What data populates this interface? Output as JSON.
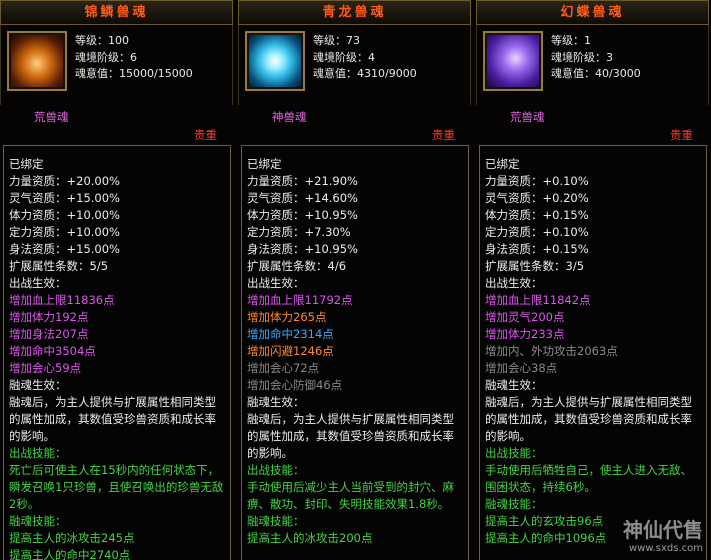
{
  "panels": [
    {
      "name": "锦鳞兽魂",
      "level": "等级：100",
      "realm": "魂境阶级：6",
      "will": "魂意值：15000/15000",
      "soul_type": "荒兽魂",
      "rarity": "贵重",
      "bound": "已绑定",
      "quals": [
        "力量资质：+20.00%",
        "灵气资质：+15.00%",
        "体力资质：+10.00%",
        "定力资质：+10.00%",
        "身法资质：+15.00%"
      ],
      "ext_count": "扩展属性条数：5/5",
      "battle_title": "出战生效：",
      "battle": [
        "增加血上限11836点",
        "增加体力192点",
        "增加身法207点",
        "增加命中3504点",
        "增加会心59点"
      ],
      "fusion_title": "融魂生效：",
      "fusion_desc": "融魂后，为主人提供与扩展属性相同类型的属性加成，其数值受珍兽资质和成长率的影响。",
      "skill_title": "出战技能：",
      "skill_desc": "死亡后可使主人在15秒内的任何状态下，瞬发召唤1只珍兽，且使召唤出的珍兽无敌2秒。",
      "fskill_title": "融魂技能：",
      "fskills": [
        "提高主人的冰攻击245点",
        "提高主人的命中2740点"
      ]
    },
    {
      "name": "青龙兽魂",
      "level": "等级：73",
      "realm": "魂境阶级：4",
      "will": "魂意值：4310/9000",
      "soul_type": "神兽魂",
      "rarity": "贵重",
      "bound": "已绑定",
      "quals": [
        "力量资质：+21.90%",
        "灵气资质：+14.60%",
        "体力资质：+10.95%",
        "定力资质：+7.30%",
        "身法资质：+10.95%"
      ],
      "ext_count": "扩展属性条数：4/6",
      "battle_title": "出战生效：",
      "battle": [
        "增加血上限11792点",
        "增加体力265点",
        "增加命中2314点",
        "增加闪避1246点",
        "增加会心72点",
        "增加会心防御46点"
      ],
      "fusion_title": "融魂生效：",
      "fusion_desc": "融魂后，为主人提供与扩展属性相同类型的属性加成，其数值受珍兽资质和成长率的影响。",
      "skill_title": "出战技能：",
      "skill_desc": "手动使用后减少主人当前受到的封穴、麻痹、散功、封印、失明技能效果1.8秒。",
      "fskill_title": "融魂技能：",
      "fskills": [
        "提高主人的冰攻击200点"
      ]
    },
    {
      "name": "幻蝶兽魂",
      "level": "等级：1",
      "realm": "魂境阶级：3",
      "will": "魂意值：40/3000",
      "soul_type": "荒兽魂",
      "rarity": "贵重",
      "bound": "已绑定",
      "quals": [
        "力量资质：+0.10%",
        "灵气资质：+0.20%",
        "体力资质：+0.15%",
        "定力资质：+0.10%",
        "身法资质：+0.15%"
      ],
      "ext_count": "扩展属性条数：3/5",
      "battle_title": "出战生效：",
      "battle": [
        "增加血上限11842点",
        "增加灵气200点",
        "增加体力233点",
        "增加内、外功攻击2063点",
        "增加会心38点"
      ],
      "fusion_title": "融魂生效：",
      "fusion_desc": "融魂后，为主人提供与扩展属性相同类型的属性加成，其数值受珍兽资质和成长率的影响。",
      "skill_title": "出战技能：",
      "skill_desc": "手动使用后牺牲自己，使主人进入无敌、围困状态，持续6秒。",
      "fskill_title": "融魂技能：",
      "fskills": [
        "提高主人的玄攻击96点",
        "提高主人的命中1096点"
      ]
    }
  ],
  "watermark": {
    "main": "神仙代售",
    "sub": "www.sxds.com"
  },
  "colors": {
    "title": "#ff5a14",
    "rarity": "#ff3a2a",
    "soul_type": "#dd66dd",
    "green": "#44d444",
    "magenta": "#dd55ee",
    "gray": "#8a8a8a",
    "orange": "#ff8a2a",
    "blue": "#33aaff"
  }
}
